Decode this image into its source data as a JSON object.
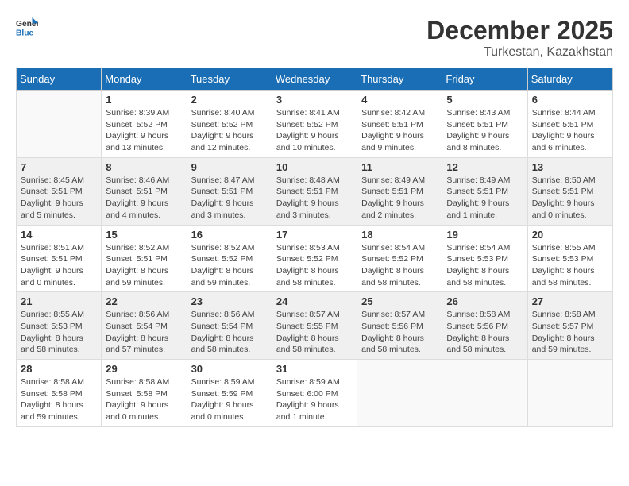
{
  "logo": {
    "text_general": "General",
    "text_blue": "Blue"
  },
  "title": "December 2025",
  "subtitle": "Turkestan, Kazakhstan",
  "weekdays": [
    "Sunday",
    "Monday",
    "Tuesday",
    "Wednesday",
    "Thursday",
    "Friday",
    "Saturday"
  ],
  "weeks": [
    [
      {
        "day": "",
        "info": ""
      },
      {
        "day": "1",
        "info": "Sunrise: 8:39 AM\nSunset: 5:52 PM\nDaylight: 9 hours\nand 13 minutes."
      },
      {
        "day": "2",
        "info": "Sunrise: 8:40 AM\nSunset: 5:52 PM\nDaylight: 9 hours\nand 12 minutes."
      },
      {
        "day": "3",
        "info": "Sunrise: 8:41 AM\nSunset: 5:52 PM\nDaylight: 9 hours\nand 10 minutes."
      },
      {
        "day": "4",
        "info": "Sunrise: 8:42 AM\nSunset: 5:51 PM\nDaylight: 9 hours\nand 9 minutes."
      },
      {
        "day": "5",
        "info": "Sunrise: 8:43 AM\nSunset: 5:51 PM\nDaylight: 9 hours\nand 8 minutes."
      },
      {
        "day": "6",
        "info": "Sunrise: 8:44 AM\nSunset: 5:51 PM\nDaylight: 9 hours\nand 6 minutes."
      }
    ],
    [
      {
        "day": "7",
        "info": "Sunrise: 8:45 AM\nSunset: 5:51 PM\nDaylight: 9 hours\nand 5 minutes."
      },
      {
        "day": "8",
        "info": "Sunrise: 8:46 AM\nSunset: 5:51 PM\nDaylight: 9 hours\nand 4 minutes."
      },
      {
        "day": "9",
        "info": "Sunrise: 8:47 AM\nSunset: 5:51 PM\nDaylight: 9 hours\nand 3 minutes."
      },
      {
        "day": "10",
        "info": "Sunrise: 8:48 AM\nSunset: 5:51 PM\nDaylight: 9 hours\nand 3 minutes."
      },
      {
        "day": "11",
        "info": "Sunrise: 8:49 AM\nSunset: 5:51 PM\nDaylight: 9 hours\nand 2 minutes."
      },
      {
        "day": "12",
        "info": "Sunrise: 8:49 AM\nSunset: 5:51 PM\nDaylight: 9 hours\nand 1 minute."
      },
      {
        "day": "13",
        "info": "Sunrise: 8:50 AM\nSunset: 5:51 PM\nDaylight: 9 hours\nand 0 minutes."
      }
    ],
    [
      {
        "day": "14",
        "info": "Sunrise: 8:51 AM\nSunset: 5:51 PM\nDaylight: 9 hours\nand 0 minutes."
      },
      {
        "day": "15",
        "info": "Sunrise: 8:52 AM\nSunset: 5:51 PM\nDaylight: 8 hours\nand 59 minutes."
      },
      {
        "day": "16",
        "info": "Sunrise: 8:52 AM\nSunset: 5:52 PM\nDaylight: 8 hours\nand 59 minutes."
      },
      {
        "day": "17",
        "info": "Sunrise: 8:53 AM\nSunset: 5:52 PM\nDaylight: 8 hours\nand 58 minutes."
      },
      {
        "day": "18",
        "info": "Sunrise: 8:54 AM\nSunset: 5:52 PM\nDaylight: 8 hours\nand 58 minutes."
      },
      {
        "day": "19",
        "info": "Sunrise: 8:54 AM\nSunset: 5:53 PM\nDaylight: 8 hours\nand 58 minutes."
      },
      {
        "day": "20",
        "info": "Sunrise: 8:55 AM\nSunset: 5:53 PM\nDaylight: 8 hours\nand 58 minutes."
      }
    ],
    [
      {
        "day": "21",
        "info": "Sunrise: 8:55 AM\nSunset: 5:53 PM\nDaylight: 8 hours\nand 58 minutes."
      },
      {
        "day": "22",
        "info": "Sunrise: 8:56 AM\nSunset: 5:54 PM\nDaylight: 8 hours\nand 57 minutes."
      },
      {
        "day": "23",
        "info": "Sunrise: 8:56 AM\nSunset: 5:54 PM\nDaylight: 8 hours\nand 58 minutes."
      },
      {
        "day": "24",
        "info": "Sunrise: 8:57 AM\nSunset: 5:55 PM\nDaylight: 8 hours\nand 58 minutes."
      },
      {
        "day": "25",
        "info": "Sunrise: 8:57 AM\nSunset: 5:56 PM\nDaylight: 8 hours\nand 58 minutes."
      },
      {
        "day": "26",
        "info": "Sunrise: 8:58 AM\nSunset: 5:56 PM\nDaylight: 8 hours\nand 58 minutes."
      },
      {
        "day": "27",
        "info": "Sunrise: 8:58 AM\nSunset: 5:57 PM\nDaylight: 8 hours\nand 59 minutes."
      }
    ],
    [
      {
        "day": "28",
        "info": "Sunrise: 8:58 AM\nSunset: 5:58 PM\nDaylight: 8 hours\nand 59 minutes."
      },
      {
        "day": "29",
        "info": "Sunrise: 8:58 AM\nSunset: 5:58 PM\nDaylight: 9 hours\nand 0 minutes."
      },
      {
        "day": "30",
        "info": "Sunrise: 8:59 AM\nSunset: 5:59 PM\nDaylight: 9 hours\nand 0 minutes."
      },
      {
        "day": "31",
        "info": "Sunrise: 8:59 AM\nSunset: 6:00 PM\nDaylight: 9 hours\nand 1 minute."
      },
      {
        "day": "",
        "info": ""
      },
      {
        "day": "",
        "info": ""
      },
      {
        "day": "",
        "info": ""
      }
    ]
  ]
}
